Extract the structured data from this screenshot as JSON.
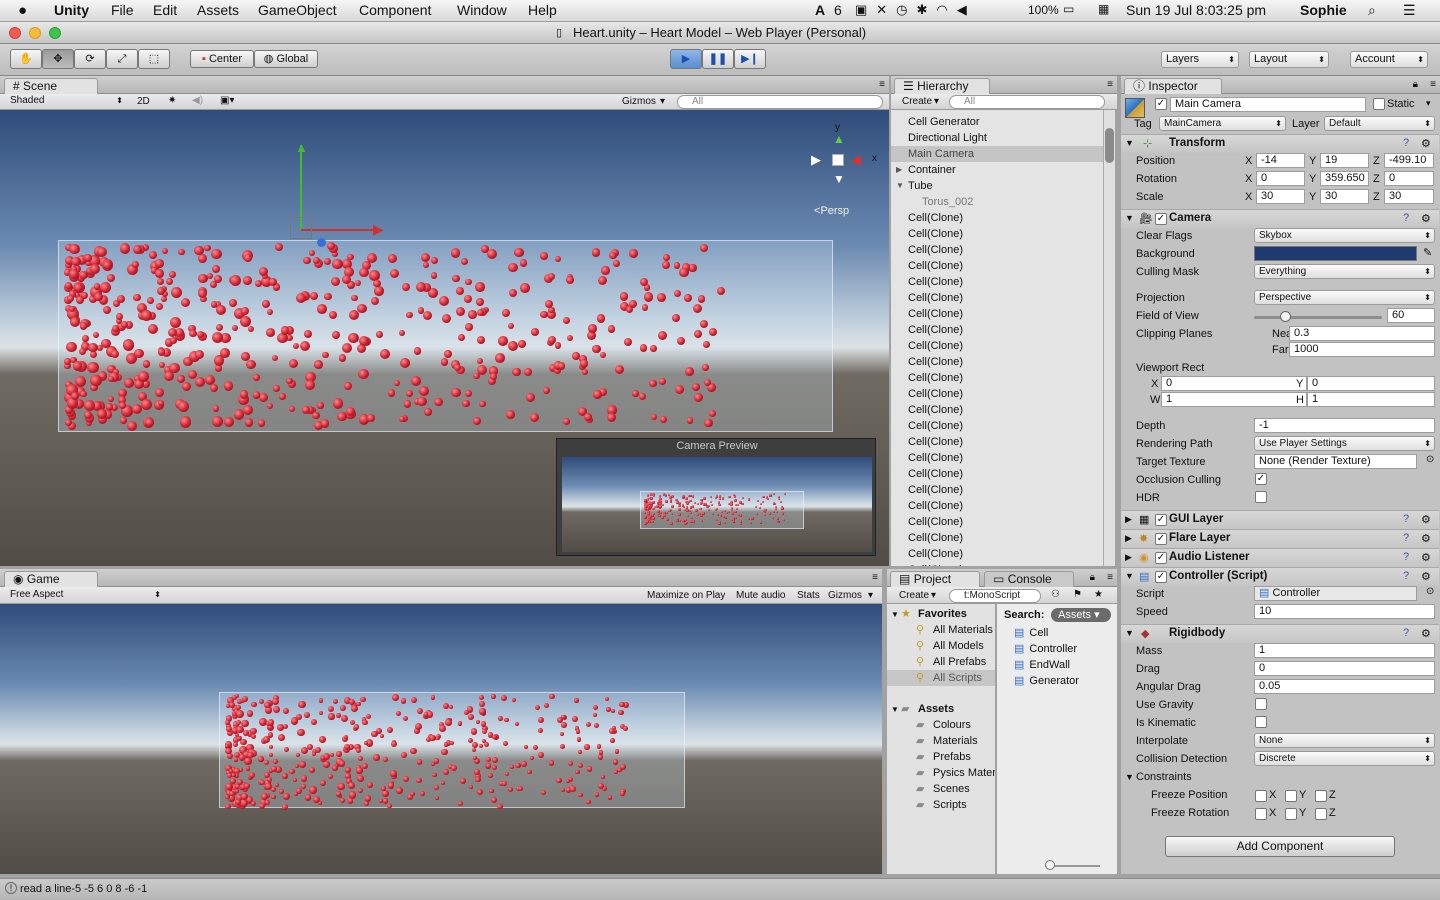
{
  "menubar": {
    "app": "Unity",
    "items": [
      "File",
      "Edit",
      "Assets",
      "GameObject",
      "Component",
      "Window",
      "Help"
    ],
    "adobe": "6",
    "battery": "100%",
    "datetime": "Sun 19 Jul  8:03:25 pm",
    "user": "Sophie"
  },
  "window": {
    "title": "Heart.unity – Heart Model – Web Player (Personal)"
  },
  "toolbar": {
    "pivot": "Center",
    "space": "Global",
    "layers": "Layers",
    "layout": "Layout",
    "account": "Account"
  },
  "scene": {
    "tab": "Scene",
    "shading": "Shaded",
    "mode2d": "2D",
    "gizmos": "Gizmos",
    "search_placeholder": "All",
    "persp": "Persp",
    "axis_x": "x",
    "axis_y": "y",
    "camera_preview": "Camera Preview"
  },
  "game": {
    "tab": "Game",
    "aspect": "Free Aspect",
    "maximize": "Maximize on Play",
    "mute": "Mute audio",
    "stats": "Stats",
    "gizmos": "Gizmos"
  },
  "hierarchy": {
    "tab": "Hierarchy",
    "create": "Create",
    "search_placeholder": "All",
    "items": [
      {
        "label": "Cell Generator",
        "indent": 0,
        "arrow": ""
      },
      {
        "label": "Directional Light",
        "indent": 0,
        "arrow": ""
      },
      {
        "label": "Main Camera",
        "indent": 0,
        "arrow": "",
        "selected": true
      },
      {
        "label": "Container",
        "indent": 0,
        "arrow": "▶"
      },
      {
        "label": "Tube",
        "indent": 0,
        "arrow": "▼"
      },
      {
        "label": "Torus_002",
        "indent": 1,
        "arrow": "",
        "dim": true
      },
      {
        "label": "Cell(Clone)",
        "indent": 0,
        "arrow": ""
      },
      {
        "label": "Cell(Clone)",
        "indent": 0,
        "arrow": ""
      },
      {
        "label": "Cell(Clone)",
        "indent": 0,
        "arrow": ""
      },
      {
        "label": "Cell(Clone)",
        "indent": 0,
        "arrow": ""
      },
      {
        "label": "Cell(Clone)",
        "indent": 0,
        "arrow": ""
      },
      {
        "label": "Cell(Clone)",
        "indent": 0,
        "arrow": ""
      },
      {
        "label": "Cell(Clone)",
        "indent": 0,
        "arrow": ""
      },
      {
        "label": "Cell(Clone)",
        "indent": 0,
        "arrow": ""
      },
      {
        "label": "Cell(Clone)",
        "indent": 0,
        "arrow": ""
      },
      {
        "label": "Cell(Clone)",
        "indent": 0,
        "arrow": ""
      },
      {
        "label": "Cell(Clone)",
        "indent": 0,
        "arrow": ""
      },
      {
        "label": "Cell(Clone)",
        "indent": 0,
        "arrow": ""
      },
      {
        "label": "Cell(Clone)",
        "indent": 0,
        "arrow": ""
      },
      {
        "label": "Cell(Clone)",
        "indent": 0,
        "arrow": ""
      },
      {
        "label": "Cell(Clone)",
        "indent": 0,
        "arrow": ""
      },
      {
        "label": "Cell(Clone)",
        "indent": 0,
        "arrow": ""
      },
      {
        "label": "Cell(Clone)",
        "indent": 0,
        "arrow": ""
      },
      {
        "label": "Cell(Clone)",
        "indent": 0,
        "arrow": ""
      },
      {
        "label": "Cell(Clone)",
        "indent": 0,
        "arrow": ""
      },
      {
        "label": "Cell(Clone)",
        "indent": 0,
        "arrow": ""
      },
      {
        "label": "Cell(Clone)",
        "indent": 0,
        "arrow": ""
      },
      {
        "label": "Cell(Clone)",
        "indent": 0,
        "arrow": ""
      },
      {
        "label": "Cell(Clone)",
        "indent": 0,
        "arrow": ""
      }
    ]
  },
  "project": {
    "tab": "Project",
    "console_tab": "Console",
    "create": "Create",
    "search_value": "t:MonoScript",
    "favorites_title": "Favorites",
    "favorites": [
      "All Materials",
      "All Models",
      "All Prefabs",
      "All Scripts"
    ],
    "assets_title": "Assets",
    "folders": [
      "Colours",
      "Materials",
      "Prefabs",
      "Pysics Materi",
      "Scenes",
      "Scripts"
    ],
    "search_label": "Search:",
    "search_scope": "Assets",
    "results": [
      "Cell",
      "Controller",
      "EndWall",
      "Generator"
    ]
  },
  "inspector": {
    "tab": "Inspector",
    "object_name": "Main Camera",
    "static": "Static",
    "tag_label": "Tag",
    "tag": "MainCamera",
    "layer_label": "Layer",
    "layer": "Default",
    "transform": {
      "title": "Transform",
      "position_label": "Position",
      "rotation_label": "Rotation",
      "scale_label": "Scale",
      "x": "X",
      "y": "Y",
      "z": "Z",
      "position": [
        "-14",
        "19",
        "-499.10"
      ],
      "rotation": [
        "0",
        "359.650",
        "0"
      ],
      "scale": [
        "30",
        "30",
        "30"
      ]
    },
    "camera": {
      "title": "Camera",
      "clear_flags_label": "Clear Flags",
      "clear_flags": "Skybox",
      "background_label": "Background",
      "background_color": "#1f3a6e",
      "culling_mask_label": "Culling Mask",
      "culling_mask": "Everything",
      "projection_label": "Projection",
      "projection": "Perspective",
      "fov_label": "Field of View",
      "fov": "60",
      "fov_fraction": 0.24,
      "clipping_label": "Clipping Planes",
      "near_label": "Near",
      "near": "0.3",
      "far_label": "Far",
      "far": "1000",
      "viewport_label": "Viewport Rect",
      "vx_label": "X",
      "vx": "0",
      "vy_label": "Y",
      "vy": "0",
      "vw_label": "W",
      "vw": "1",
      "vh_label": "H",
      "vh": "1",
      "depth_label": "Depth",
      "depth": "-1",
      "rendering_path_label": "Rendering Path",
      "rendering_path": "Use Player Settings",
      "target_texture_label": "Target Texture",
      "target_texture": "None (Render Texture)",
      "occlusion_label": "Occlusion Culling",
      "hdr_label": "HDR"
    },
    "gui_layer": "GUI Layer",
    "flare_layer": "Flare Layer",
    "audio_listener": "Audio Listener",
    "controller": {
      "title": "Controller (Script)",
      "script_label": "Script",
      "script": "Controller",
      "speed_label": "Speed",
      "speed": "10"
    },
    "rigidbody": {
      "title": "Rigidbody",
      "mass_label": "Mass",
      "mass": "1",
      "drag_label": "Drag",
      "drag": "0",
      "angular_drag_label": "Angular Drag",
      "angular_drag": "0.05",
      "use_gravity_label": "Use Gravity",
      "is_kinematic_label": "Is Kinematic",
      "interpolate_label": "Interpolate",
      "interpolate": "None",
      "collision_label": "Collision Detection",
      "collision": "Discrete",
      "constraints_label": "Constraints",
      "freeze_position_label": "Freeze Position",
      "freeze_rotation_label": "Freeze Rotation",
      "x": "X",
      "y": "Y",
      "z": "Z"
    },
    "add_component": "Add Component"
  },
  "status": {
    "text": "read a line-5 -5 6 0 8 -6 -1"
  },
  "colors": {
    "accent_play": "#3a7fd8",
    "selection": "#c8c8c8"
  }
}
